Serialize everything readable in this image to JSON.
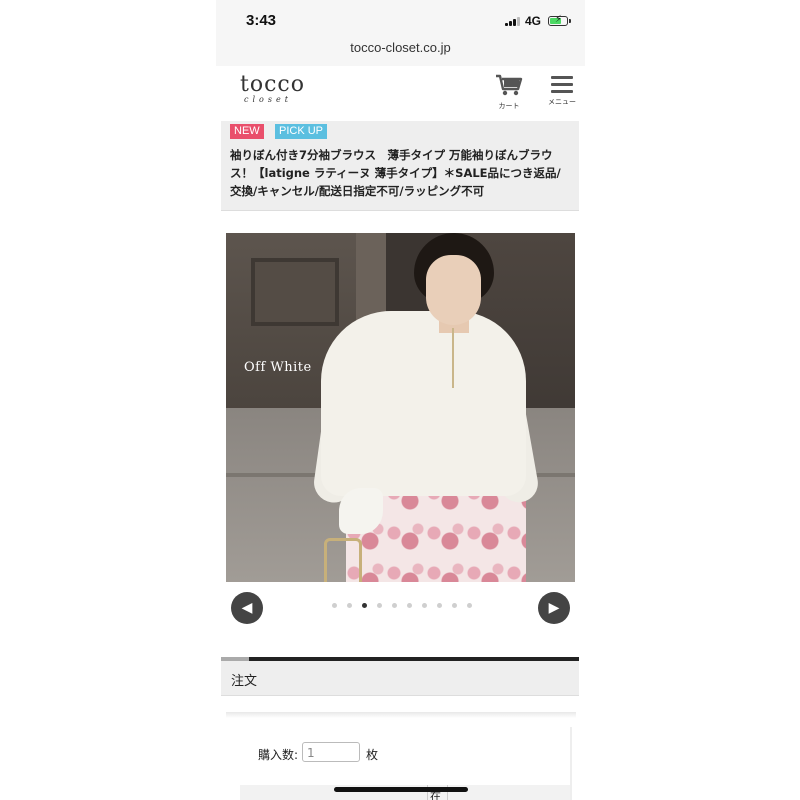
{
  "status": {
    "time": "3:43",
    "network": "4G"
  },
  "browser": {
    "url": "tocco-closet.co.jp"
  },
  "header": {
    "logo_main": "tocco",
    "logo_sub": "closet",
    "cart_label": "カート",
    "menu_label": "メニュー"
  },
  "product": {
    "badge_new": "NEW",
    "badge_pickup": "PICK UP",
    "title": "袖りぼん付き7分袖ブラウス　薄手タイプ 万能袖りぼんブラウス！【latigne ラティーヌ 薄手タイプ】＊SALE品につき返品/交換/キャンセル/配送日指定不可/ラッピング不可",
    "image_caption": "Off White"
  },
  "carousel": {
    "dot_count": 10,
    "active_index": 2,
    "prev_icon": "chevron-left-icon",
    "next_icon": "chevron-right-icon"
  },
  "order": {
    "heading": "注文",
    "qty_label": "購入数:",
    "qty_value": "1",
    "qty_unit": "枚",
    "table_cell": "在"
  },
  "colors": {
    "badge_new": "#e94f6b",
    "badge_pickup": "#5bbfe0",
    "battery": "#4cd964"
  }
}
